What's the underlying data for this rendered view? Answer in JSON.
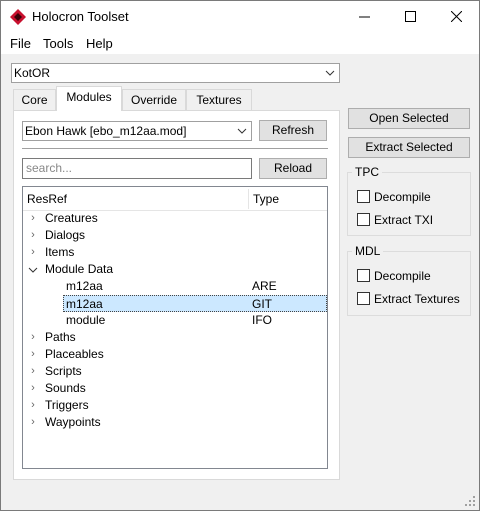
{
  "window": {
    "title": "Holocron Toolset"
  },
  "menu": {
    "file": "File",
    "tools": "Tools",
    "help": "Help"
  },
  "game_select": {
    "value": "KotOR"
  },
  "tabs": [
    {
      "label": "Core"
    },
    {
      "label": "Modules"
    },
    {
      "label": "Override"
    },
    {
      "label": "Textures"
    }
  ],
  "modules": {
    "module_select": "Ebon Hawk [ebo_m12aa.mod]",
    "refresh": "Refresh",
    "search_placeholder": "search...",
    "reload": "Reload"
  },
  "tree": {
    "col_resref": "ResRef",
    "col_type": "Type",
    "rows": [
      {
        "label": "Creatures"
      },
      {
        "label": "Dialogs"
      },
      {
        "label": "Items"
      },
      {
        "label": "Module Data"
      },
      {
        "label": "m12aa",
        "type": "ARE"
      },
      {
        "label": "m12aa",
        "type": "GIT"
      },
      {
        "label": "module",
        "type": "IFO"
      },
      {
        "label": "Paths"
      },
      {
        "label": "Placeables"
      },
      {
        "label": "Scripts"
      },
      {
        "label": "Sounds"
      },
      {
        "label": "Triggers"
      },
      {
        "label": "Waypoints"
      }
    ]
  },
  "actions": {
    "open_selected": "Open Selected",
    "extract_selected": "Extract Selected"
  },
  "tpc": {
    "title": "TPC",
    "decompile": "Decompile",
    "extract_txi": "Extract TXI"
  },
  "mdl": {
    "title": "MDL",
    "decompile": "Decompile",
    "extract_textures": "Extract Textures"
  },
  "colors": {
    "accent": "#cce8ff",
    "icon_red": "#c8102e"
  }
}
